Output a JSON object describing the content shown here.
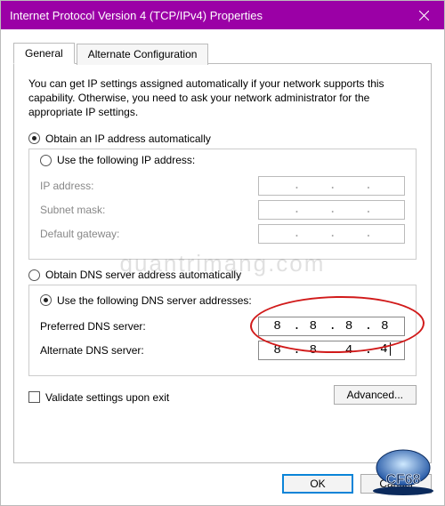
{
  "window": {
    "title": "Internet Protocol Version 4 (TCP/IPv4) Properties"
  },
  "tabs": {
    "general": "General",
    "alt": "Alternate Configuration"
  },
  "desc": "You can get IP settings assigned automatically if your network supports this capability. Otherwise, you need to ask your network administrator for the appropriate IP settings.",
  "ip": {
    "auto": "Obtain an IP address automatically",
    "manual": "Use the following IP address:",
    "ip_label": "IP address:",
    "mask_label": "Subnet mask:",
    "gw_label": "Default gateway:"
  },
  "dns": {
    "auto": "Obtain DNS server address automatically",
    "manual": "Use the following DNS server addresses:",
    "pref_label": "Preferred DNS server:",
    "alt_label": "Alternate DNS server:",
    "pref_value": [
      "8",
      "8",
      "8",
      "8"
    ],
    "alt_value": [
      "8",
      "8",
      "4",
      "4"
    ]
  },
  "validate": "Validate settings upon exit",
  "buttons": {
    "advanced": "Advanced...",
    "ok": "OK",
    "cancel": "Cancel"
  },
  "watermark": "quantrimang.com",
  "logo": "CF68"
}
